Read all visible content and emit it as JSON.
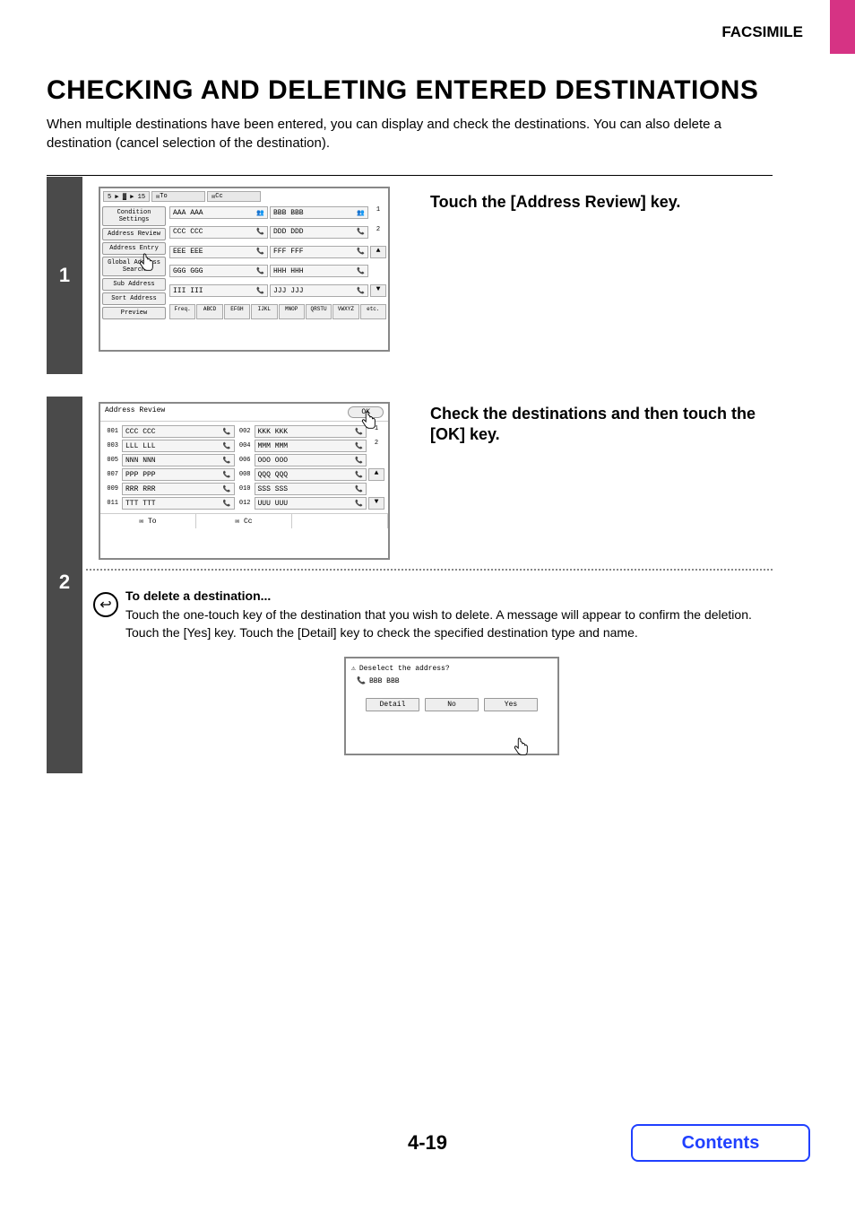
{
  "header": {
    "section": "FACSIMILE"
  },
  "title": "CHECKING AND DELETING ENTERED DESTINATIONS",
  "intro": "When multiple destinations have been entered, you can display and check the destinations. You can also delete a destination (cancel selection of the destination).",
  "step1": {
    "number": "1",
    "instruction": "Touch the [Address Review] key.",
    "panel": {
      "top_path": "5 ▶ ▓ ▶ 15",
      "to_tab": "To",
      "cc_tab": "Cc",
      "side_buttons": [
        "Condition Settings",
        "Address Review",
        "Address Entry",
        "Global Address Search",
        "Sub Address",
        "Sort Address",
        "Preview"
      ],
      "keys_left": [
        "AAA AAA",
        "CCC CCC",
        "EEE EEE",
        "GGG GGG",
        "III III"
      ],
      "keys_right": [
        "BBB BBB",
        "DDD DDD",
        "FFF FFF",
        "HHH HHH",
        "JJJ JJJ"
      ],
      "page": {
        "current": "1",
        "total": "2"
      },
      "alpha": [
        "Freq.",
        "ABCD",
        "EFGH",
        "IJKL",
        "MNOP",
        "QRSTU",
        "VWXYZ",
        "etc."
      ]
    }
  },
  "step2": {
    "number": "2",
    "instruction": "Check the destinations and then touch the [OK] key.",
    "panel": {
      "title": "Address Review",
      "ok": "OK",
      "rows": [
        {
          "n": "001",
          "l": "CCC CCC",
          "n2": "002",
          "r": "KKK KKK"
        },
        {
          "n": "003",
          "l": "LLL LLL",
          "n2": "004",
          "r": "MMM MMM"
        },
        {
          "n": "005",
          "l": "NNN NNN",
          "n2": "006",
          "r": "OOO OOO"
        },
        {
          "n": "007",
          "l": "PPP PPP",
          "n2": "008",
          "r": "QQQ QQQ"
        },
        {
          "n": "009",
          "l": "RRR RRR",
          "n2": "010",
          "r": "SSS SSS"
        },
        {
          "n": "011",
          "l": "TTT TTT",
          "n2": "012",
          "r": "UUU UUU"
        }
      ],
      "page": {
        "current": "1",
        "total": "2"
      },
      "footer_to": "To",
      "footer_cc": "Cc"
    },
    "note_title": "To delete a destination...",
    "note_body": "Touch the one-touch key of the destination that you wish to delete. A message will appear to confirm the deletion. Touch the [Yes] key. Touch the [Detail] key to check the specified destination type and name.",
    "dialog": {
      "message": "Deselect the address?",
      "dest": "BBB BBB",
      "detail": "Detail",
      "no": "No",
      "yes": "Yes"
    }
  },
  "page_number": "4-19",
  "contents": "Contents"
}
